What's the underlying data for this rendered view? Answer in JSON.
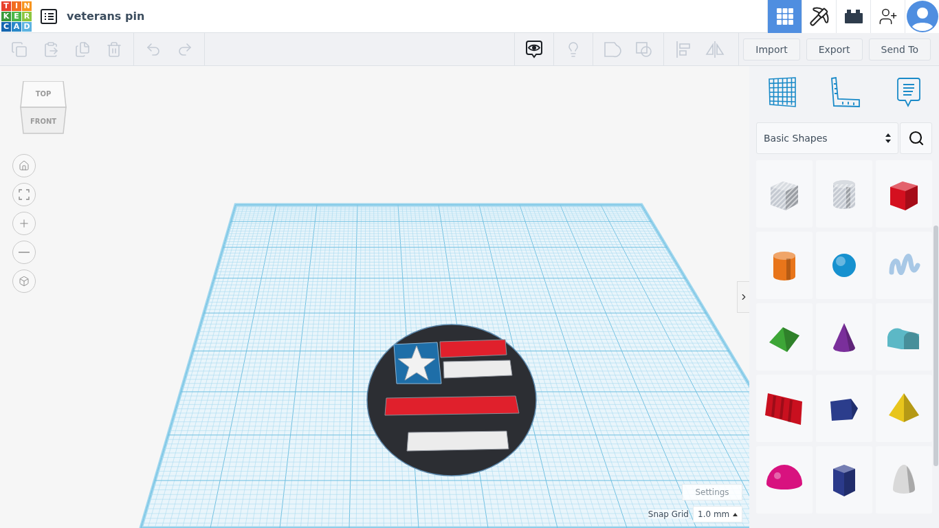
{
  "logo": {
    "letters": [
      "T",
      "I",
      "N",
      "K",
      "E",
      "R",
      "C",
      "A",
      "D"
    ]
  },
  "title": "veterans pin",
  "nav": [
    {
      "kind": "design",
      "selected": true
    },
    {
      "kind": "pickaxe",
      "selected": false
    },
    {
      "kind": "bricks",
      "selected": false
    },
    {
      "kind": "invite",
      "selected": false
    },
    {
      "kind": "avatar",
      "selected": false
    }
  ],
  "toolbar": {
    "groups": [
      {
        "tools": [
          {
            "kind": "copy",
            "disabled": true
          },
          {
            "kind": "paste",
            "disabled": true
          },
          {
            "kind": "duplicate",
            "disabled": true
          },
          {
            "kind": "delete",
            "disabled": true
          }
        ]
      },
      {
        "tools": [
          {
            "kind": "undo",
            "disabled": true
          },
          {
            "kind": "redo",
            "disabled": true
          }
        ]
      }
    ],
    "view_groups": [
      {
        "tools": [
          {
            "kind": "notes",
            "disabled": false
          }
        ]
      },
      {
        "tools": [
          {
            "kind": "light",
            "disabled": true
          }
        ]
      },
      {
        "tools": [
          {
            "kind": "group",
            "disabled": true
          },
          {
            "kind": "ungroup",
            "disabled": true
          }
        ]
      },
      {
        "tools": [
          {
            "kind": "align",
            "disabled": true
          },
          {
            "kind": "mirror",
            "disabled": true
          }
        ]
      }
    ],
    "actions": [
      "Import",
      "Export",
      "Send To"
    ]
  },
  "view_cube": {
    "top": "TOP",
    "front": "FRONT"
  },
  "view_controls": [
    {
      "kind": "home"
    },
    {
      "kind": "fit"
    },
    {
      "kind": "zoom-in"
    },
    {
      "kind": "zoom-out"
    },
    {
      "kind": "ortho"
    }
  ],
  "panel": {
    "tabs": [
      {
        "kind": "workplane"
      },
      {
        "kind": "ruler"
      },
      {
        "kind": "notes"
      }
    ],
    "library": "Basic Shapes",
    "shapes": [
      {
        "kind": "box-hole",
        "color": "#c4c9d1"
      },
      {
        "kind": "cylinder-hole",
        "color": "#c4c9d1"
      },
      {
        "kind": "box",
        "color": "#d4101f"
      },
      {
        "kind": "cylinder",
        "color": "#e8751a"
      },
      {
        "kind": "sphere",
        "color": "#1691cf"
      },
      {
        "kind": "scribble",
        "color": "#a8c8e6"
      },
      {
        "kind": "roof",
        "color": "#3da637"
      },
      {
        "kind": "cone",
        "color": "#7a2f9b"
      },
      {
        "kind": "round-roof",
        "color": "#5cb8c6"
      },
      {
        "kind": "text",
        "color": "#c9101f"
      },
      {
        "kind": "wedge",
        "color": "#2b3d8c"
      },
      {
        "kind": "pyramid",
        "color": "#e8c51c"
      },
      {
        "kind": "half-sphere",
        "color": "#d8127f"
      },
      {
        "kind": "polygon",
        "color": "#2b3a8a"
      },
      {
        "kind": "paraboloid",
        "color": "#d9d9d9"
      }
    ]
  },
  "bottom": {
    "settings": "Settings",
    "snap_label": "Snap Grid",
    "snap_value": "1.0 mm"
  }
}
